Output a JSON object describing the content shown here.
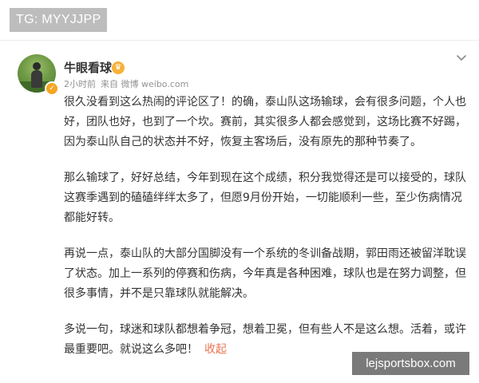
{
  "tag_badge": "TG: MYYJJPP",
  "post": {
    "author": "牛眼看球",
    "time": "2小时前",
    "source": "来自 微博 weibo.com",
    "paragraphs": [
      "很久没看到这么热闹的评论区了！的确，泰山队这场输球，会有很多问题，个人也好，团队也好，也到了一个坎。赛前，其实很多人都会感觉到，这场比赛不好踢，因为泰山队自己的状态并不好，恢复主客场后，没有原先的那种节奏了。",
      "那么输球了，好好总结，今年到现在这个成绩，积分我觉得还是可以接受的，球队这赛季遇到的磕磕绊绊太多了，但愿9月份开始，一切能顺利一些，至少伤病情况都能好转。",
      "再说一点，泰山队的大部分国脚没有一个系统的冬训备战期，郭田雨还被留洋耽误了状态。加上一系列的停赛和伤病，今年真是各种困难，球队也是在努力调整，但很多事情，并不是只靠球队就能解决。",
      "多说一句，球迷和球队都想着争冠，想着卫冕，但有些人不是这么想。活着，或许最重要吧。就说这么多吧！"
    ],
    "collapse_label": "收起"
  },
  "watermark": "lejsportsbox.com",
  "colors": {
    "link": "#eb7350",
    "meta": "#939393",
    "text": "#333333"
  },
  "icons": {
    "verified": "verified-badge-icon",
    "vip": "vip-crown-icon",
    "menu": "chevron-down-icon"
  }
}
